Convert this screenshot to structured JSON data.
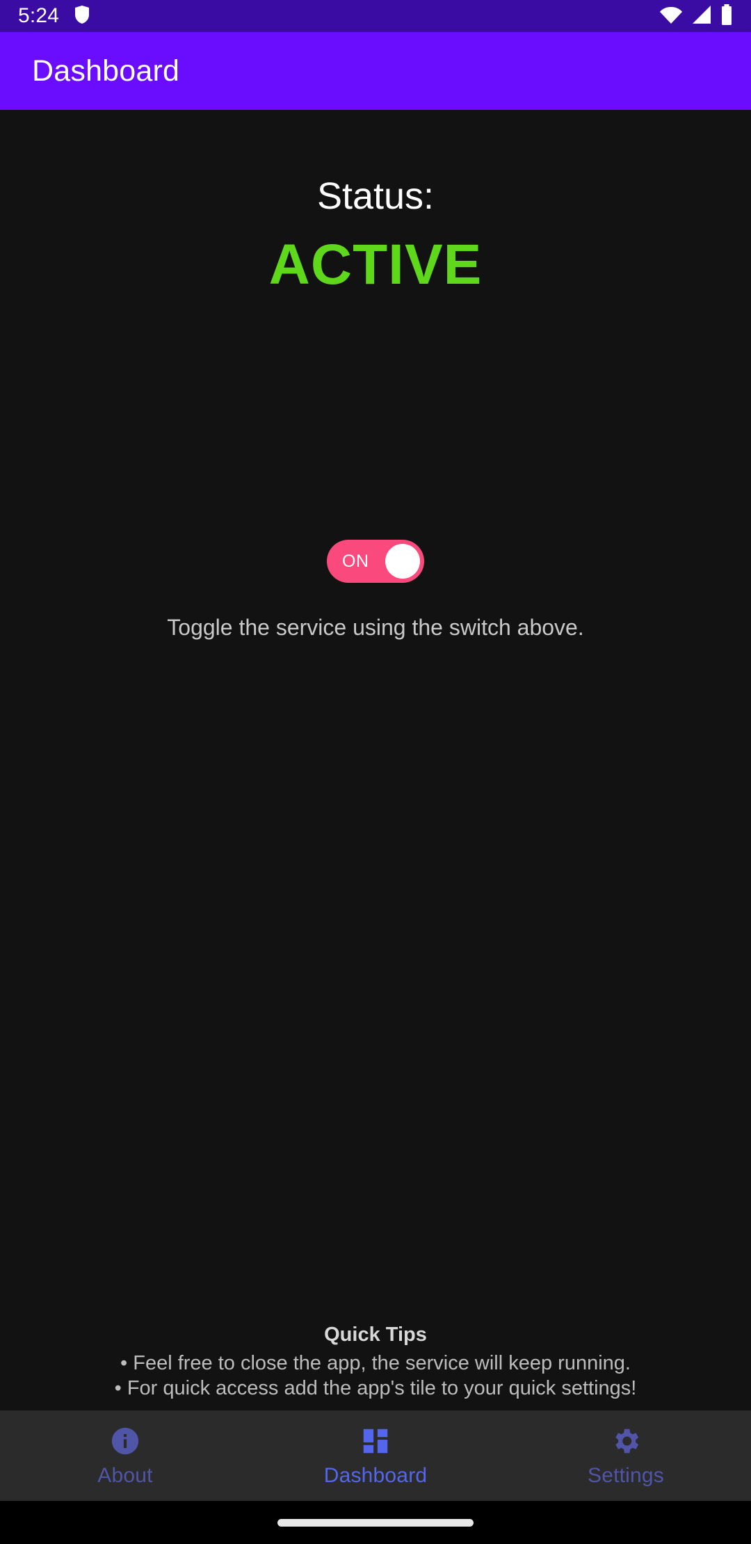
{
  "status_bar": {
    "clock": "5:24",
    "icons": [
      "shield-icon",
      "wifi-icon",
      "cellular-signal-icon",
      "battery-icon"
    ]
  },
  "app_bar": {
    "title": "Dashboard",
    "background_color": "#6A0DFF"
  },
  "main": {
    "status_label": "Status:",
    "status_value": "ACTIVE",
    "status_value_color": "#5FD71A",
    "toggle": {
      "label": "ON",
      "state": "on",
      "track_color": "#FA4A7D",
      "knob_color": "#FFFFFF"
    },
    "hint": "Toggle the service using the switch above.",
    "background_color": "#121212"
  },
  "quick_tips": {
    "title": "Quick Tips",
    "lines": [
      "• Feel free to close the app, the service will keep running.",
      "• For quick access add the app's tile to your quick settings!"
    ]
  },
  "bottom_nav": {
    "background_color": "#2B2B2B",
    "active_color": "#5566EE",
    "inactive_color": "#5055A8",
    "items": [
      {
        "label": "About",
        "icon": "info-circle-icon",
        "active": false
      },
      {
        "label": "Dashboard",
        "icon": "dashboard-grid-icon",
        "active": true
      },
      {
        "label": "Settings",
        "icon": "gear-icon",
        "active": false
      }
    ]
  }
}
